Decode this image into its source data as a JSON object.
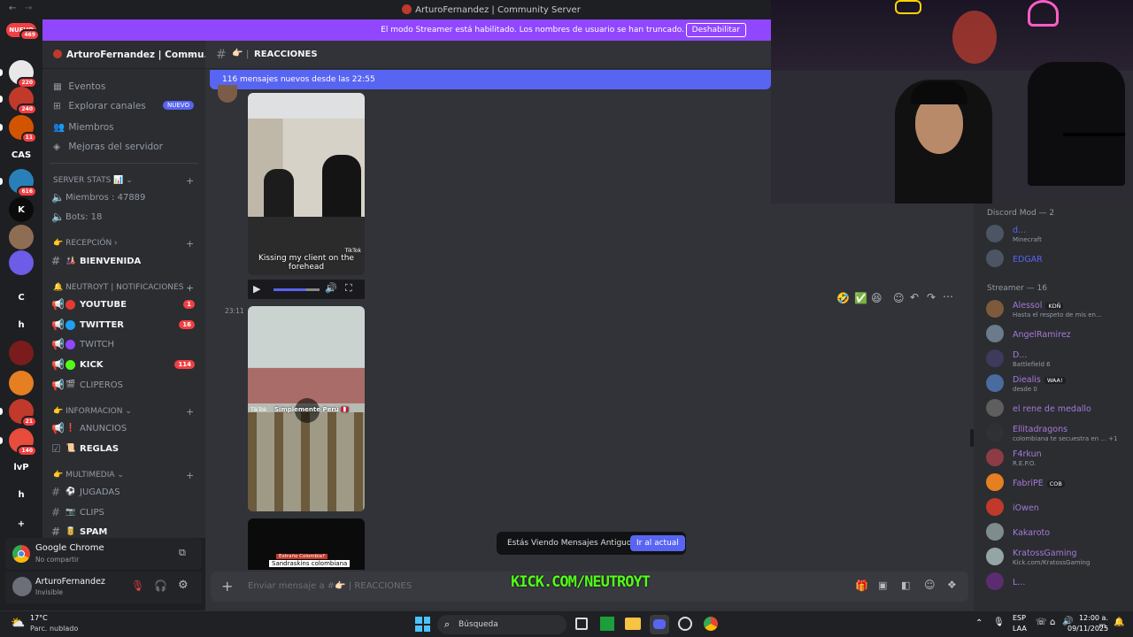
{
  "titlebar": {
    "title": "ArturoFernandez | Community Server",
    "back": "←",
    "forward": "→"
  },
  "banner": {
    "text": "El modo Streamer está habilitado. Los nombres de usuario se han truncado.",
    "button": "Deshabilitar"
  },
  "servers": [
    {
      "label": "NUEVO",
      "badge": "469",
      "color": "#f23f43"
    },
    {
      "label": "",
      "badge": "220",
      "color": "#e8e8e8"
    },
    {
      "label": "",
      "badge": "240",
      "color": "#c0392b"
    },
    {
      "label": "",
      "badge": "11",
      "color": "#d35400"
    },
    {
      "label": "CAS",
      "badge": "",
      "color": "#1e1f22"
    },
    {
      "label": "",
      "badge": "616",
      "color": "#2980b9"
    },
    {
      "label": "K",
      "badge": "",
      "color": "#0b0b0b"
    },
    {
      "label": "",
      "badge": "",
      "color": "#8e6e53"
    },
    {
      "label": "",
      "badge": "",
      "color": "#6c5ce7"
    },
    {
      "label": "C",
      "badge": "",
      "color": "#1e1f22"
    },
    {
      "label": "h",
      "badge": "",
      "color": "#1e1f22"
    },
    {
      "label": "",
      "badge": "",
      "color": "#7a1c1c"
    },
    {
      "label": "",
      "badge": "",
      "color": "#e67e22"
    },
    {
      "label": "",
      "badge": "21",
      "color": "#c0392b"
    },
    {
      "label": "",
      "badge": "140",
      "color": "#e74c3c"
    },
    {
      "label": "lvP",
      "badge": "",
      "color": "#1e1f22"
    },
    {
      "label": "h",
      "badge": "",
      "color": "#1e1f22"
    },
    {
      "label": "+",
      "badge": "",
      "color": "#1e1f22"
    }
  ],
  "sidebar": {
    "server_name": "ArturoFernandez | Commu...",
    "nav": [
      {
        "label": "Eventos",
        "icon": "calendar-icon"
      },
      {
        "label": "Explorar canales",
        "icon": "compass-icon",
        "badge": "NUEVO"
      },
      {
        "label": "Miembros",
        "icon": "members-icon"
      },
      {
        "label": "Mejoras del servidor",
        "icon": "boost-icon"
      }
    ],
    "cat_stats": "SERVER STATS 📊",
    "stats_members": "Miembros : 47889",
    "stats_bots": "Bots: 18",
    "cat_recepcion": "RECEPCIÓN",
    "chan_bienvenida": "BIENVENIDA",
    "cat_notif": "NEUTROYT | NOTIFICACIONES",
    "chan_youtube": "YOUTUBE",
    "badge_youtube": "1",
    "chan_twitter": "TWITTER",
    "badge_twitter": "16",
    "chan_twitch": "TWITCH",
    "chan_kick": "KICK",
    "badge_kick": "114",
    "chan_clipers": "CLIPEROS",
    "cat_info": "INFORMACION",
    "chan_anuncios": "ANUNCIOS",
    "chan_reglas": "REGLAS",
    "cat_multimedia": "MULTIMEDIA",
    "chan_jugadas": "JUGADAS",
    "chan_clips": "CLIPS",
    "chan_spam": "SPAM"
  },
  "activity": {
    "app": "Google Chrome",
    "status": "No compartir"
  },
  "user": {
    "name": "ArturoFernandez",
    "status": "Invisible"
  },
  "channel": {
    "name": "REACCIONES",
    "emoji": "👉🏻"
  },
  "new_messages": "116 mensajes nuevos desde las 22:55",
  "messages": [
    {
      "time": "",
      "caption": "Kissing my client on the forehead",
      "watermark": "TikTok"
    },
    {
      "time": "23:11",
      "caption": "Simplemente Perú 🇵🇪",
      "watermark": "TikTok"
    },
    {
      "time": "",
      "caption": "Sandraskins colombiana",
      "caption2": "Extraño Colombia?"
    }
  ],
  "old_messages": {
    "label": "Estás Viendo Mensajes Antiguos",
    "button": "Ir al actual"
  },
  "composer": {
    "placeholder": "Enviar mensaje a #👉🏻 | REACCIONES"
  },
  "overlay": {
    "kick": "KICK.COM/NEUTROYT"
  },
  "members": {
    "group_mod": "Discord Mod — 2",
    "mods": [
      {
        "name": "d...",
        "sub": "Minecraft",
        "color": "#5865f2"
      },
      {
        "name": "EDGAR",
        "sub": "",
        "color": "#5865f2"
      }
    ],
    "group_streamer": "Streamer — 16",
    "streamers": [
      {
        "name": "Alessol",
        "tag": "KDÑ",
        "sub": "Hasta el respeto de mis en..."
      },
      {
        "name": "AngelRamirez",
        "tag": "",
        "sub": ""
      },
      {
        "name": "D...",
        "tag": "",
        "sub": "Battlefield 6"
      },
      {
        "name": "Diealis",
        "tag": "WAA!",
        "sub": "desde 0"
      },
      {
        "name": "el rene de medallo",
        "tag": "",
        "sub": ""
      },
      {
        "name": "Ellitadragons",
        "tag": "",
        "sub": "colombiana te secuestra en ... +1"
      },
      {
        "name": "F4rkun",
        "tag": "",
        "sub": "R.E.P.O."
      },
      {
        "name": "FabriPE",
        "tag": "COB",
        "sub": ""
      },
      {
        "name": "iOwen",
        "tag": "",
        "sub": ""
      },
      {
        "name": "Kakaroto",
        "tag": "",
        "sub": ""
      },
      {
        "name": "KratossGaming",
        "tag": "",
        "sub": "Kick.com/KratossGaming"
      },
      {
        "name": "L...",
        "tag": "",
        "sub": ""
      }
    ]
  },
  "taskbar": {
    "weather_temp": "17°C",
    "weather_desc": "Parc. nublado",
    "search": "Búsqueda",
    "lang": "ESP",
    "lang2": "LAA",
    "time": "12:00 a. m.",
    "date": "09/11/2025"
  }
}
